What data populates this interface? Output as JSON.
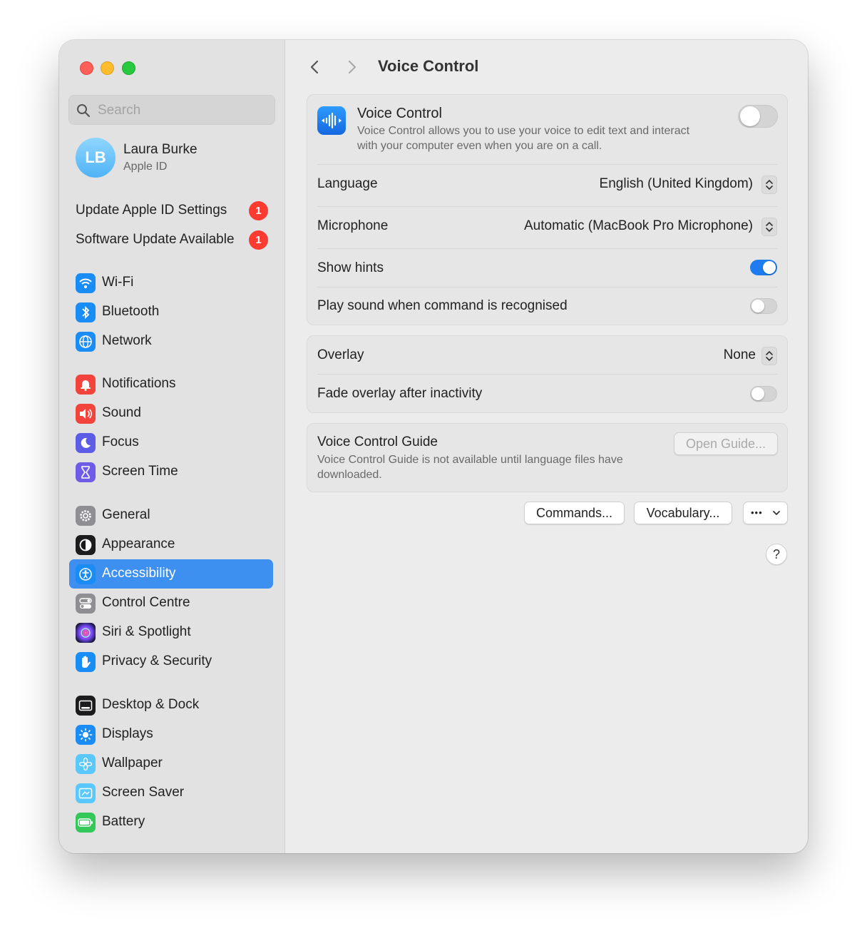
{
  "window": {
    "page_title": "Voice Control"
  },
  "sidebar": {
    "search_placeholder": "Search",
    "profile": {
      "initials": "LB",
      "name": "Laura Burke",
      "subtitle": "Apple ID"
    },
    "alerts": [
      {
        "label": "Update Apple ID Settings",
        "badge": "1"
      },
      {
        "label": "Software Update Available",
        "badge": "1"
      }
    ],
    "items": [
      {
        "label": "Wi-Fi",
        "icon": "wifi-icon",
        "color": "#1a8cf5"
      },
      {
        "label": "Bluetooth",
        "icon": "bluetooth-icon",
        "color": "#1a8cf5"
      },
      {
        "label": "Network",
        "icon": "globe-icon",
        "color": "#1a8cf5"
      },
      {
        "label": "Notifications",
        "icon": "bell-icon",
        "color": "#f2443c"
      },
      {
        "label": "Sound",
        "icon": "speaker-icon",
        "color": "#f2443c"
      },
      {
        "label": "Focus",
        "icon": "moon-icon",
        "color": "#5d5ce6"
      },
      {
        "label": "Screen Time",
        "icon": "hourglass-icon",
        "color": "#6e5ce6"
      },
      {
        "label": "General",
        "icon": "gear-icon",
        "color": "#8e8e93"
      },
      {
        "label": "Appearance",
        "icon": "appearance-icon",
        "color": "#1c1c1e"
      },
      {
        "label": "Accessibility",
        "icon": "accessibility-icon",
        "color": "#1a8cf5",
        "selected": true
      },
      {
        "label": "Control Centre",
        "icon": "control-centre-icon",
        "color": "#8e8e93"
      },
      {
        "label": "Siri & Spotlight",
        "icon": "siri-icon",
        "color": "#2b2b6e"
      },
      {
        "label": "Privacy & Security",
        "icon": "hand-icon",
        "color": "#1a8cf5"
      },
      {
        "label": "Desktop & Dock",
        "icon": "dock-icon",
        "color": "#1c1c1e"
      },
      {
        "label": "Displays",
        "icon": "sun-icon",
        "color": "#1a8cf5"
      },
      {
        "label": "Wallpaper",
        "icon": "flower-icon",
        "color": "#5ac8fa"
      },
      {
        "label": "Screen Saver",
        "icon": "screensaver-icon",
        "color": "#5ac8fa"
      },
      {
        "label": "Battery",
        "icon": "battery-icon",
        "color": "#34c759"
      }
    ]
  },
  "voice_control": {
    "title": "Voice Control",
    "description_line1": "Voice Control allows you to use your voice to edit text and interact",
    "description_line2": "with your computer even when you are on a call.",
    "enabled": false,
    "language_label": "Language",
    "language_value": "English (United Kingdom)",
    "microphone_label": "Microphone",
    "microphone_value": "Automatic (MacBook Pro Microphone)",
    "show_hints_label": "Show hints",
    "show_hints": true,
    "play_sound_label": "Play sound when command is recognised",
    "play_sound": false
  },
  "overlay": {
    "overlay_label": "Overlay",
    "overlay_value": "None",
    "fade_label": "Fade overlay after inactivity",
    "fade": false
  },
  "guide": {
    "title": "Voice Control Guide",
    "description_line1": "Voice Control Guide is not available until language files have",
    "description_line2": "downloaded.",
    "button": "Open Guide..."
  },
  "actions": {
    "commands": "Commands...",
    "vocabulary": "Vocabulary...",
    "more": "•••",
    "help": "?"
  },
  "colors": {
    "accent": "#1f7cf0",
    "selected_sidebar": "#3d8ff0",
    "badge": "#fe3b30"
  }
}
